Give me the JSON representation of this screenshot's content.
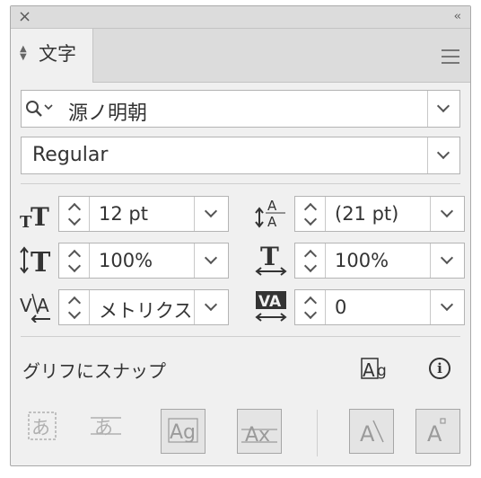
{
  "window": {
    "close_glyph": "×",
    "collapse_glyph": "‹‹"
  },
  "tab": {
    "label": "文字"
  },
  "font_family": {
    "value": "源ノ明朝"
  },
  "font_style": {
    "value": "Regular"
  },
  "fields": {
    "font_size": "12 pt",
    "leading": "(21 pt)",
    "vertical_scale": "100%",
    "horizontal_scale": "100%",
    "kerning": "メトリクス",
    "tracking": "0"
  },
  "snap": {
    "label": "グリフにスナップ",
    "info_glyph": "i"
  },
  "icons": {
    "vertical_scale_glyph": "↕T",
    "kerning_glyph": "V/A"
  },
  "colors": {
    "panel_bg": "#f0f0f0",
    "titlebar_bg": "#dcdcdc",
    "text": "#333333",
    "disabled_icon": "#b0b0b0"
  }
}
